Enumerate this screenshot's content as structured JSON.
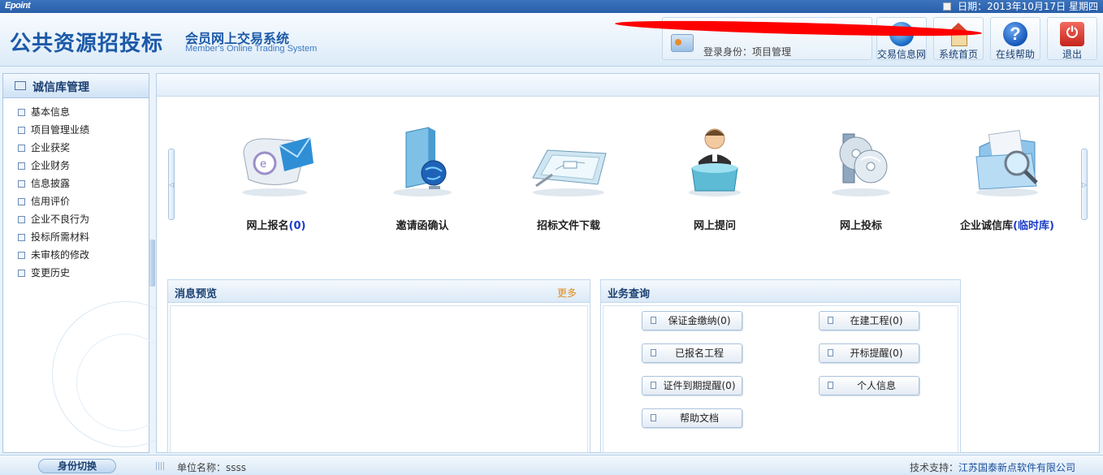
{
  "topbar": {
    "logo": "Epoint",
    "date": "日期：2013年10月17日 星期四"
  },
  "header": {
    "title_main": "公共资源招投标",
    "title_sub": "会员网上交易系统",
    "title_en": "Member's Online Trading System",
    "login_label": "登录身份：项目管理",
    "buttons": [
      {
        "label": "交易信息网",
        "icon": "globe-icon"
      },
      {
        "label": "系统首页",
        "icon": "home-icon"
      },
      {
        "label": "在线帮助",
        "icon": "help-icon"
      },
      {
        "label": "退出",
        "icon": "power-icon"
      }
    ],
    "help_glyph": "?",
    "exit_glyph": "⏻"
  },
  "sidebar": {
    "title": "诚信库管理",
    "items": [
      {
        "label": "基本信息"
      },
      {
        "label": "项目管理业绩"
      },
      {
        "label": "企业获奖"
      },
      {
        "label": "企业财务"
      },
      {
        "label": "信息披露"
      },
      {
        "label": "信用评价"
      },
      {
        "label": "企业不良行为"
      },
      {
        "label": "投标所需材料"
      },
      {
        "label": "未审核的修改"
      },
      {
        "label": "变更历史"
      }
    ]
  },
  "carousel": {
    "left_arrow": "◁",
    "right_arrow": "▷",
    "tiles": [
      {
        "label": "网上报名",
        "count": "(0)",
        "icon": "mail-icon"
      },
      {
        "label": "邀请函确认",
        "count": "",
        "icon": "globe-book-icon"
      },
      {
        "label": "招标文件下载",
        "count": "",
        "icon": "document-tray-icon"
      },
      {
        "label": "网上提问",
        "count": "",
        "icon": "support-agent-icon"
      },
      {
        "label": "网上投标",
        "count": "",
        "icon": "disc-icon"
      },
      {
        "label": "企业诚信库",
        "count": "(临时库)",
        "icon": "folder-search-icon"
      }
    ]
  },
  "messages": {
    "title": "消息预览",
    "more": "更多"
  },
  "business": {
    "title": "业务查询",
    "buttons": [
      {
        "label": "保证金缴纳(0)"
      },
      {
        "label": "在建工程(0)"
      },
      {
        "label": "已报名工程"
      },
      {
        "label": "开标提醒(0)"
      },
      {
        "label": "证件到期提醒(0)"
      },
      {
        "label": "个人信息"
      },
      {
        "label": "帮助文档"
      }
    ]
  },
  "footer": {
    "switch_label": "身份切换",
    "unit_label": "单位名称：ssss",
    "support_prefix": "技术支持：",
    "support_company": "江苏国泰新点软件有限公司"
  }
}
